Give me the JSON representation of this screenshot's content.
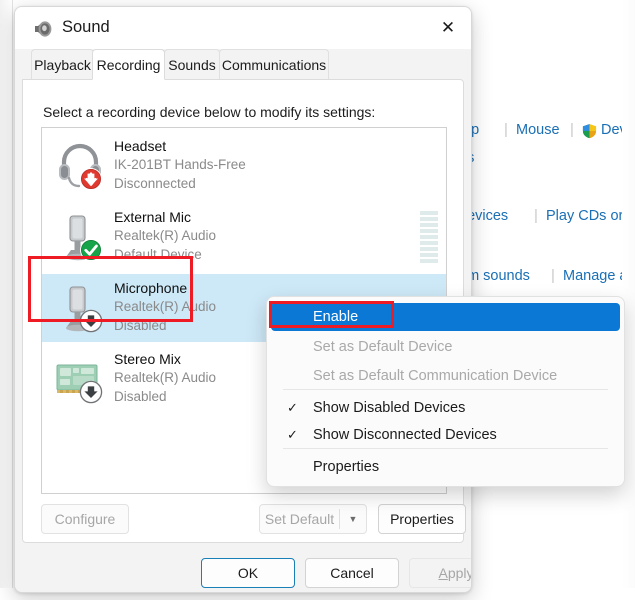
{
  "background": {
    "name": "control-panel-window",
    "links_row1": [
      "tup",
      "Mouse",
      "Devi"
    ],
    "links_row1_full": [
      "Mouse"
    ],
    "wrap_text": "ns",
    "links_row2": [
      "devices",
      "Play CDs or ot"
    ],
    "links_row3": [
      "em sounds",
      "Manage a"
    ],
    "separator": "|",
    "shield_icon": "shield-icon",
    "link_color": "#1a6fb5"
  },
  "dialog": {
    "title": "Sound",
    "title_icon": "speaker-icon",
    "close_icon": "✕",
    "tabs": [
      {
        "label": "Playback",
        "active": false
      },
      {
        "label": "Recording",
        "active": true
      },
      {
        "label": "Sounds",
        "active": false
      },
      {
        "label": "Communications",
        "active": false
      }
    ],
    "instruction": "Select a recording device below to modify its settings:",
    "devices": [
      {
        "name": "Headset",
        "driver": "IK-201BT Hands-Free",
        "status": "Disconnected",
        "icon": "headset-icon",
        "badge": "down-arrow-red-badge",
        "selected": false
      },
      {
        "name": "External Mic",
        "driver": "Realtek(R) Audio",
        "status": "Default Device",
        "icon": "microphone-icon",
        "badge": "check-green-badge",
        "selected": false
      },
      {
        "name": "Microphone",
        "driver": "Realtek(R) Audio",
        "status": "Disabled",
        "icon": "microphone-icon",
        "badge": "down-arrow-gray-badge",
        "selected": true
      },
      {
        "name": "Stereo Mix",
        "driver": "Realtek(R) Audio",
        "status": "Disabled",
        "icon": "sound-card-icon",
        "badge": "down-arrow-gray-badge",
        "selected": false
      }
    ],
    "level_meter": {
      "name": "audio-level-meter",
      "segments": 9,
      "active": 0
    },
    "panel_buttons": {
      "configure": "Configure",
      "set_default": "Set Default",
      "set_default_arrow": "▼",
      "properties": "Properties"
    },
    "footer_buttons": {
      "ok": "OK",
      "cancel": "Cancel",
      "apply_prefix": "A",
      "apply_rest": "pply"
    }
  },
  "context_menu": {
    "items": [
      {
        "label": "Enable",
        "state": "highlighted",
        "check": ""
      },
      {
        "label": "Set as Default Device",
        "state": "disabled",
        "check": ""
      },
      {
        "label": "Set as Default Communication Device",
        "state": "disabled",
        "check": ""
      },
      {
        "label": "Show Disabled Devices",
        "state": "checked",
        "check": "✓"
      },
      {
        "label": "Show Disconnected Devices",
        "state": "checked",
        "check": "✓"
      },
      {
        "label": "Properties",
        "state": "normal",
        "check": ""
      }
    ],
    "highlight_color": "#0a78d4"
  },
  "annotations": {
    "device_box": "red-highlight-microphone-row",
    "enable_box": "red-highlight-enable-item",
    "color": "#ee1b24"
  }
}
